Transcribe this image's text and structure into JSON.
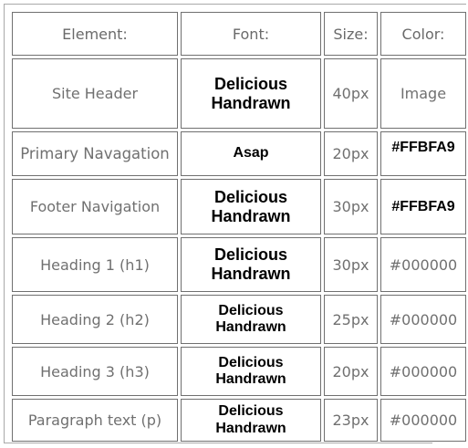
{
  "table": {
    "headers": [
      "Element:",
      "Font:",
      "Size:",
      "Color:"
    ],
    "rows": [
      {
        "element": "Site Header",
        "font": "Delicious Handrawn",
        "size": "40px",
        "color": "Image"
      },
      {
        "element": "Primary Navagation",
        "font": "Asap",
        "size": "20px",
        "color": "#FFBFA9"
      },
      {
        "element": "Footer Navigation",
        "font": "Delicious Handrawn",
        "size": "30px",
        "color": "#FFBFA9"
      },
      {
        "element": "Heading 1 (h1)",
        "font": "Delicious Handrawn",
        "size": "30px",
        "color": "#000000"
      },
      {
        "element": "Heading 2 (h2)",
        "font": "Delicious Handrawn",
        "size": "25px",
        "color": "#000000"
      },
      {
        "element": "Heading 3 (h3)",
        "font": "Delicious Handrawn",
        "size": "20px",
        "color": "#000000"
      },
      {
        "element": "Paragraph text (p)",
        "font": "Delicious Handrawn",
        "size": "23px",
        "color": "#000000"
      }
    ]
  }
}
